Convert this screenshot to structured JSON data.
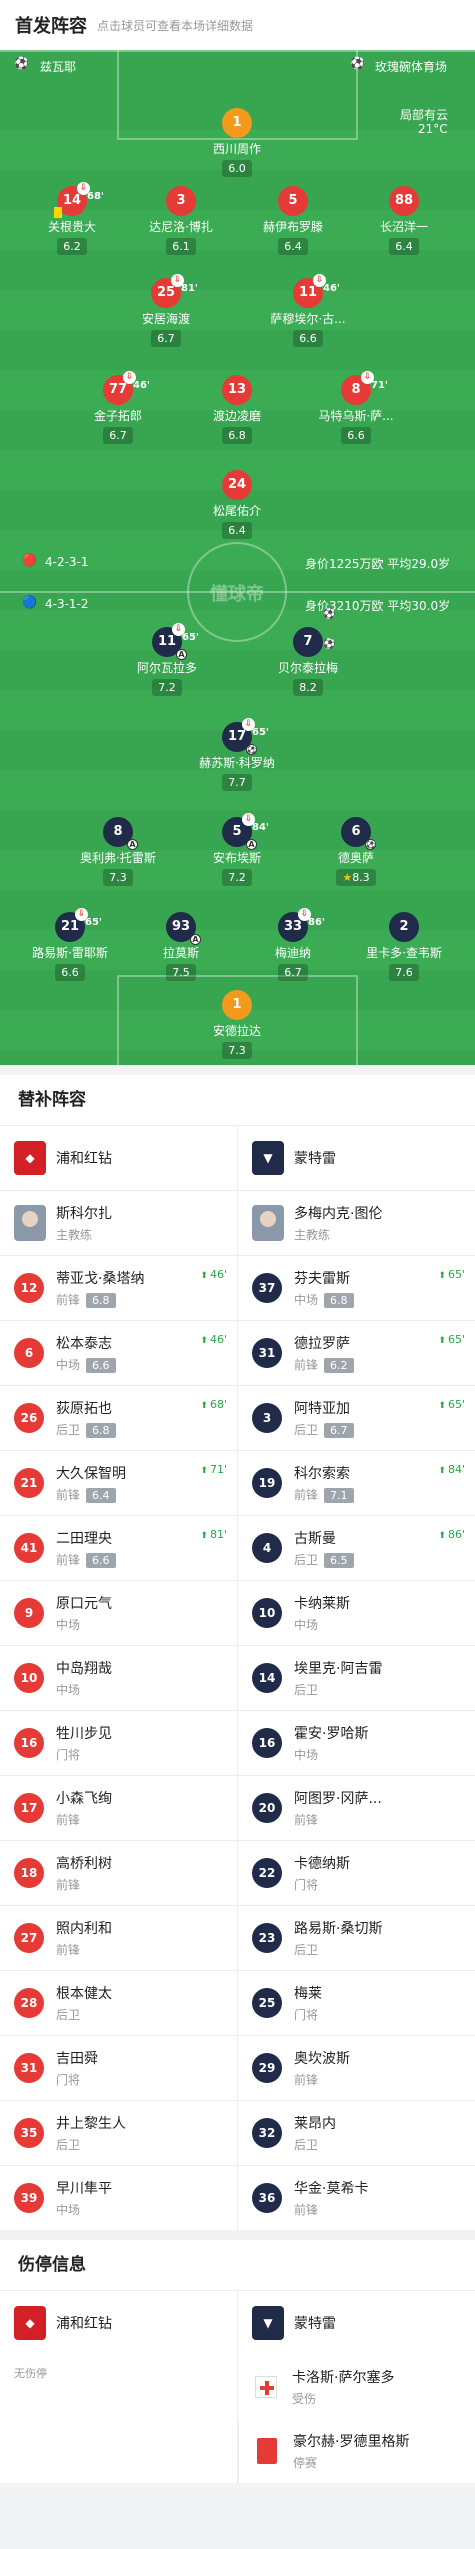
{
  "header": {
    "title": "首发阵容",
    "subtitle": "点击球员可查看本场详细数据"
  },
  "pitch": {
    "home_venue_label": "兹瓦耶",
    "away_venue_label": "玫瑰碗体育场",
    "weather": "局部有云",
    "temperature": "21°C",
    "watermark": "懂球帝",
    "home_formation": "4-2-3-1",
    "home_value": "身价1225万欧  平均29.0岁",
    "away_formation": "4-3-1-2",
    "away_value": "身价3210万欧  平均30.0岁"
  },
  "home_players": [
    {
      "num": "1",
      "name": "西川周作",
      "rating": "6.0"
    },
    {
      "num": "14",
      "name": "关根贵大",
      "rating": "6.2",
      "sub": "68'"
    },
    {
      "num": "3",
      "name": "达尼洛·博扎",
      "rating": "6.1"
    },
    {
      "num": "5",
      "name": "赫伊布罗滕",
      "rating": "6.4"
    },
    {
      "num": "88",
      "name": "长沼洋一",
      "rating": "6.4"
    },
    {
      "num": "25",
      "name": "安居海渡",
      "rating": "6.7",
      "sub": "81'"
    },
    {
      "num": "11",
      "name": "萨穆埃尔·古...",
      "rating": "6.6",
      "sub": "46'"
    },
    {
      "num": "77",
      "name": "金子拓郎",
      "rating": "6.7",
      "sub": "46'"
    },
    {
      "num": "13",
      "name": "渡边凌磨",
      "rating": "6.8"
    },
    {
      "num": "8",
      "name": "马特乌斯·萨...",
      "rating": "6.6",
      "sub": "71'"
    },
    {
      "num": "24",
      "name": "松尾佑介",
      "rating": "6.4"
    }
  ],
  "away_players": [
    {
      "num": "11",
      "name": "阿尔瓦拉多",
      "rating": "7.2",
      "sub": "65'"
    },
    {
      "num": "7",
      "name": "贝尔泰拉梅",
      "rating": "8.2"
    },
    {
      "num": "17",
      "name": "赫苏斯·科罗纳",
      "rating": "7.7",
      "sub": "65'"
    },
    {
      "num": "8",
      "name": "奥利弗·托雷斯",
      "rating": "7.3"
    },
    {
      "num": "5",
      "name": "安布埃斯",
      "rating": "7.2",
      "sub": "84'"
    },
    {
      "num": "6",
      "name": "德奥萨",
      "rating": "8.3"
    },
    {
      "num": "21",
      "name": "路易斯·雷耶斯",
      "rating": "6.6",
      "sub": "65'"
    },
    {
      "num": "93",
      "name": "拉莫斯",
      "rating": "7.5"
    },
    {
      "num": "33",
      "name": "梅迪纳",
      "rating": "6.7",
      "sub": "86'"
    },
    {
      "num": "2",
      "name": "里卡多·查韦斯",
      "rating": "7.6"
    },
    {
      "num": "1",
      "name": "安德拉达",
      "rating": "7.3"
    }
  ],
  "subs": {
    "title": "替补阵容",
    "home_team": "浦和红钻",
    "away_team": "蒙特雷",
    "home_coach": {
      "name": "斯科尔扎",
      "role": "主教练"
    },
    "away_coach": {
      "name": "多梅内克·图伦",
      "role": "主教练"
    },
    "rows": [
      [
        {
          "num": "12",
          "name": "蒂亚戈·桑塔纳",
          "pos": "前锋",
          "rating": "6.8",
          "in": "46'"
        },
        {
          "num": "37",
          "name": "芬夫雷斯",
          "pos": "中场",
          "rating": "6.8",
          "in": "65'"
        }
      ],
      [
        {
          "num": "6",
          "name": "松本泰志",
          "pos": "中场",
          "rating": "6.6",
          "in": "46'"
        },
        {
          "num": "31",
          "name": "德拉罗萨",
          "pos": "前锋",
          "rating": "6.2",
          "in": "65'"
        }
      ],
      [
        {
          "num": "26",
          "name": "荻原拓也",
          "pos": "后卫",
          "rating": "6.8",
          "in": "68'"
        },
        {
          "num": "3",
          "name": "阿特亚加",
          "pos": "后卫",
          "rating": "6.7",
          "in": "65'"
        }
      ],
      [
        {
          "num": "21",
          "name": "大久保智明",
          "pos": "前锋",
          "rating": "6.4",
          "in": "71'"
        },
        {
          "num": "19",
          "name": "科尔索索",
          "pos": "前锋",
          "rating": "7.1",
          "in": "84'"
        }
      ],
      [
        {
          "num": "41",
          "name": "二田理央",
          "pos": "前锋",
          "rating": "6.6",
          "in": "81'"
        },
        {
          "num": "4",
          "name": "古斯曼",
          "pos": "后卫",
          "rating": "6.5",
          "in": "86'"
        }
      ],
      [
        {
          "num": "9",
          "name": "原口元气",
          "pos": "中场"
        },
        {
          "num": "10",
          "name": "卡纳莱斯",
          "pos": "中场"
        }
      ],
      [
        {
          "num": "10",
          "name": "中岛翔哉",
          "pos": "中场"
        },
        {
          "num": "14",
          "name": "埃里克·阿吉雷",
          "pos": "后卫"
        }
      ],
      [
        {
          "num": "16",
          "name": "牲川步见",
          "pos": "门将"
        },
        {
          "num": "16",
          "name": "霍安·罗哈斯",
          "pos": "中场"
        }
      ],
      [
        {
          "num": "17",
          "name": "小森飞绚",
          "pos": "前锋"
        },
        {
          "num": "20",
          "name": "阿图罗·冈萨...",
          "pos": "前锋"
        }
      ],
      [
        {
          "num": "18",
          "name": "高桥利树",
          "pos": "前锋"
        },
        {
          "num": "22",
          "name": "卡德纳斯",
          "pos": "门将"
        }
      ],
      [
        {
          "num": "27",
          "name": "照内利和",
          "pos": "前锋"
        },
        {
          "num": "23",
          "name": "路易斯·桑切斯",
          "pos": "后卫"
        }
      ],
      [
        {
          "num": "28",
          "name": "根本健太",
          "pos": "后卫"
        },
        {
          "num": "25",
          "name": "梅莱",
          "pos": "门将"
        }
      ],
      [
        {
          "num": "31",
          "name": "吉田舜",
          "pos": "门将"
        },
        {
          "num": "29",
          "name": "奥坎波斯",
          "pos": "前锋"
        }
      ],
      [
        {
          "num": "35",
          "name": "井上黎生人",
          "pos": "后卫"
        },
        {
          "num": "32",
          "name": "莱昂内",
          "pos": "后卫"
        }
      ],
      [
        {
          "num": "39",
          "name": "早川隼平",
          "pos": "中场"
        },
        {
          "num": "36",
          "name": "华金·莫希卡",
          "pos": "前锋"
        }
      ]
    ]
  },
  "injuries": {
    "title": "伤停信息",
    "home_team": "浦和红钻",
    "away_team": "蒙特雷",
    "home_none": "无伤停",
    "away": [
      {
        "name": "卡洛斯·萨尔塞多",
        "status": "受伤",
        "icon": "medical-cross-icon"
      },
      {
        "name": "豪尔赫·罗德里格斯",
        "status": "停赛",
        "icon": "red-card-icon"
      }
    ]
  }
}
